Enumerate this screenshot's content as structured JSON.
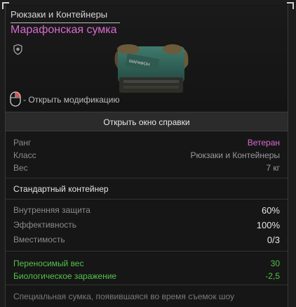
{
  "header": {
    "category": "Рюкзаки и Контейнеры",
    "item_name": "Марафонская сумка",
    "mod_hint": "- Открыть модификацию",
    "bag_label": "МАРАФОН"
  },
  "help_button": "Открыть окно справки",
  "info": [
    {
      "key": "Ранг",
      "value": "Ветеран"
    },
    {
      "key": "Класс",
      "value": "Рюкзаки и Контейнеры"
    },
    {
      "key": "Вес",
      "value": "7 кг"
    }
  ],
  "subtitle": "Стандартный контейнер",
  "stats": [
    {
      "key": "Внутренняя защита",
      "value": "60%"
    },
    {
      "key": "Эффективность",
      "value": "100%"
    },
    {
      "key": "Вместимость",
      "value": "0/3"
    }
  ],
  "bonuses": [
    {
      "key": "Переносимый вес",
      "value": "30"
    },
    {
      "key": "Биологическое заражение",
      "value": "-2,5"
    }
  ],
  "description": "Специальная сумка, появившаяся во время съемок шоу",
  "colors": {
    "rank": "#d86bd0",
    "bonus": "#55c24a",
    "name": "#d86bd0"
  }
}
